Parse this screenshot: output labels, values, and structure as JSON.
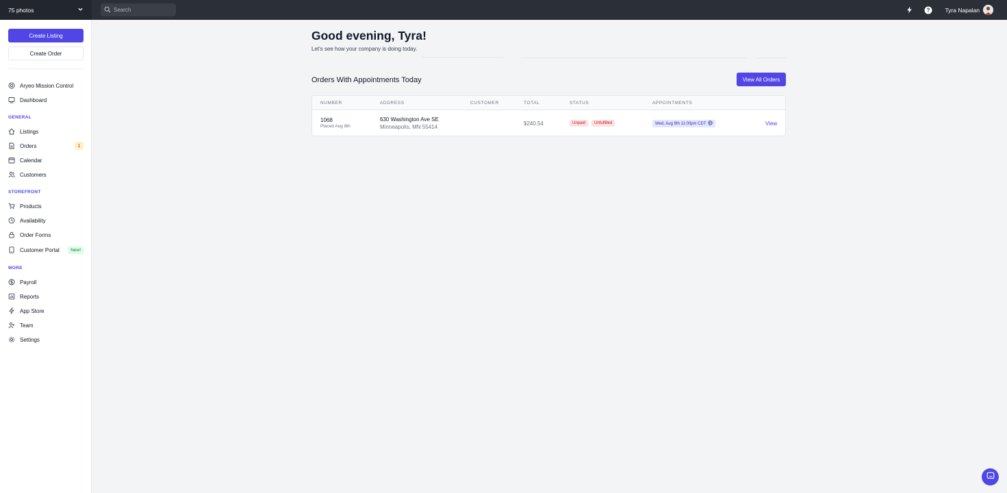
{
  "topbar": {
    "workspace_label": "75 photos",
    "search_placeholder": "Search",
    "user_name": "Tyra Napalan"
  },
  "sidebar": {
    "create_listing": "Create Listing",
    "create_order": "Create Order",
    "top_items": [
      {
        "label": "Aryeo Mission Control",
        "icon": "mission-control-icon"
      },
      {
        "label": "Dashboard",
        "icon": "dashboard-icon"
      }
    ],
    "general": {
      "label": "GENERAL",
      "items": [
        {
          "label": "Listings",
          "icon": "home-icon"
        },
        {
          "label": "Orders",
          "icon": "document-icon",
          "badge": "1"
        },
        {
          "label": "Calendar",
          "icon": "calendar-icon"
        },
        {
          "label": "Customers",
          "icon": "users-icon"
        }
      ]
    },
    "storefront": {
      "label": "STOREFRONT",
      "items": [
        {
          "label": "Products",
          "icon": "cart-icon"
        },
        {
          "label": "Availability",
          "icon": "clock-icon"
        },
        {
          "label": "Order Forms",
          "icon": "lock-icon"
        },
        {
          "label": "Customer Portal",
          "icon": "portal-icon",
          "badge": "New!"
        }
      ]
    },
    "more": {
      "label": "MORE",
      "items": [
        {
          "label": "Payroll",
          "icon": "dollar-icon"
        },
        {
          "label": "Reports",
          "icon": "reports-icon"
        },
        {
          "label": "App Store",
          "icon": "bolt-icon"
        },
        {
          "label": "Team",
          "icon": "team-icon"
        },
        {
          "label": "Settings",
          "icon": "gear-icon"
        }
      ]
    }
  },
  "main": {
    "greeting": "Good evening, Tyra!",
    "subgreeting": "Let's see how your company is doing today.",
    "section_title": "Orders With Appointments Today",
    "view_all": "View All Orders",
    "table": {
      "headers": [
        "NUMBER",
        "ADDRESS",
        "CUSTOMER",
        "TOTAL",
        "STATUS",
        "APPOINTMENTS"
      ],
      "rows": [
        {
          "number": "1068",
          "placed": "Placed Aug 8th",
          "address_line1": "630 Washington Ave SE",
          "address_line2": "Minneapolis, MN 55414",
          "customer": "",
          "total": "$240.54",
          "status_payment": "Unpaid",
          "status_fulfillment": "Unfulfilled",
          "appointment": "Wed, Aug 9th 11:00pm CDT",
          "action": "View"
        }
      ]
    }
  },
  "colors": {
    "accent": "#4f46e5",
    "topbar": "#2b2f38",
    "background": "#f3f4f6"
  }
}
